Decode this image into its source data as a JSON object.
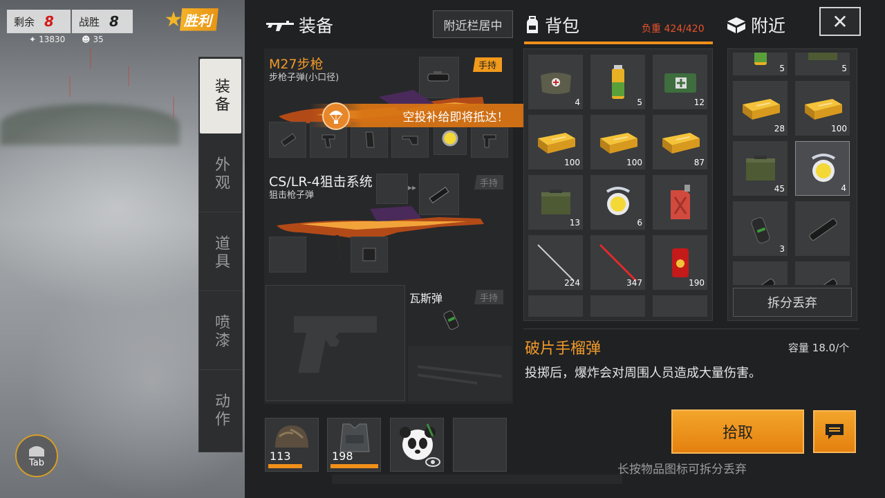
{
  "hud": {
    "remaining_label": "剩余",
    "remaining_value": "8",
    "wins_label": "战胜",
    "wins_value": "8",
    "stat1": "13830",
    "stat2": "35",
    "victory_badge": "胜利",
    "tab_label": "Tab"
  },
  "side_tabs": [
    {
      "label": "装备",
      "active": true
    },
    {
      "label": "外观",
      "active": false
    },
    {
      "label": "道具",
      "active": false
    },
    {
      "label": "喷漆",
      "active": false
    },
    {
      "label": "动作",
      "active": false
    }
  ],
  "equipment": {
    "title": "装备",
    "nearby_bar_button": "附近栏居中",
    "primary": {
      "name": "M27步枪",
      "ammo": "步枪子弹(小口径)",
      "hold_tag": "手持"
    },
    "secondary": {
      "name": "CS/LR-4狙击系统",
      "ammo": "狙击枪子弹",
      "hold_tag": "手持"
    },
    "throwable": {
      "name": "瓦斯弹",
      "hold_tag": "手持"
    },
    "airdrop_banner": "空投补给即将抵达！",
    "armor": [
      {
        "icon": "helmet-icon",
        "value": "113",
        "durability": 0.7
      },
      {
        "icon": "vest-icon",
        "value": "198",
        "durability": 0.99
      },
      {
        "icon": "panda-backpack-icon",
        "value": ""
      },
      {
        "icon": "empty-slot",
        "value": ""
      }
    ]
  },
  "backpack": {
    "title": "背包",
    "weight_label": "负重",
    "weight_value": "424/420",
    "items": [
      {
        "icon": "medkit-bag-icon",
        "count": "4"
      },
      {
        "icon": "energy-drink-icon",
        "count": "5"
      },
      {
        "icon": "first-aid-kit-icon",
        "count": "12"
      },
      {
        "icon": "ammo-box-icon",
        "count": "100"
      },
      {
        "icon": "ammo-box-icon",
        "count": "100"
      },
      {
        "icon": "ammo-box-icon",
        "count": "87"
      },
      {
        "icon": "ammo-can-icon",
        "count": "13"
      },
      {
        "icon": "grenade-orb-icon",
        "count": "6"
      },
      {
        "icon": "jerry-can-icon",
        "count": ""
      },
      {
        "icon": "arrow-icon",
        "count": "224"
      },
      {
        "icon": "red-arrow-icon",
        "count": "347"
      },
      {
        "icon": "red-can-icon",
        "count": "190"
      },
      {
        "icon": "empty-slot",
        "count": ""
      },
      {
        "icon": "empty-slot",
        "count": ""
      },
      {
        "icon": "empty-slot",
        "count": ""
      }
    ]
  },
  "nearby": {
    "title": "附近",
    "items": [
      {
        "icon": "energy-drink-icon",
        "count": "5"
      },
      {
        "icon": "ammo-can-icon",
        "count": "5"
      },
      {
        "icon": "ammo-box-icon",
        "count": "28"
      },
      {
        "icon": "ammo-box-icon",
        "count": "100"
      },
      {
        "icon": "ammo-can-icon",
        "count": "45"
      },
      {
        "icon": "grenade-orb-icon",
        "count": "4"
      },
      {
        "icon": "frag-grenade-icon",
        "count": "3"
      },
      {
        "icon": "scope-icon",
        "count": ""
      },
      {
        "icon": "scope-icon",
        "count": ""
      },
      {
        "icon": "scope-icon",
        "count": ""
      }
    ],
    "drop_button": "拆分丢弃"
  },
  "detail": {
    "item_name": "破片手榴弹",
    "capacity_label": "容量",
    "capacity_value": "18.0/个",
    "description": "投掷后，爆炸会对周围人员造成大量伤害。",
    "pick_button": "拾取",
    "hint": "长按物品图标可拆分丢弃"
  },
  "colors": {
    "accent": "#f08f1a",
    "warning": "#e8532c",
    "panel": "#202123"
  }
}
